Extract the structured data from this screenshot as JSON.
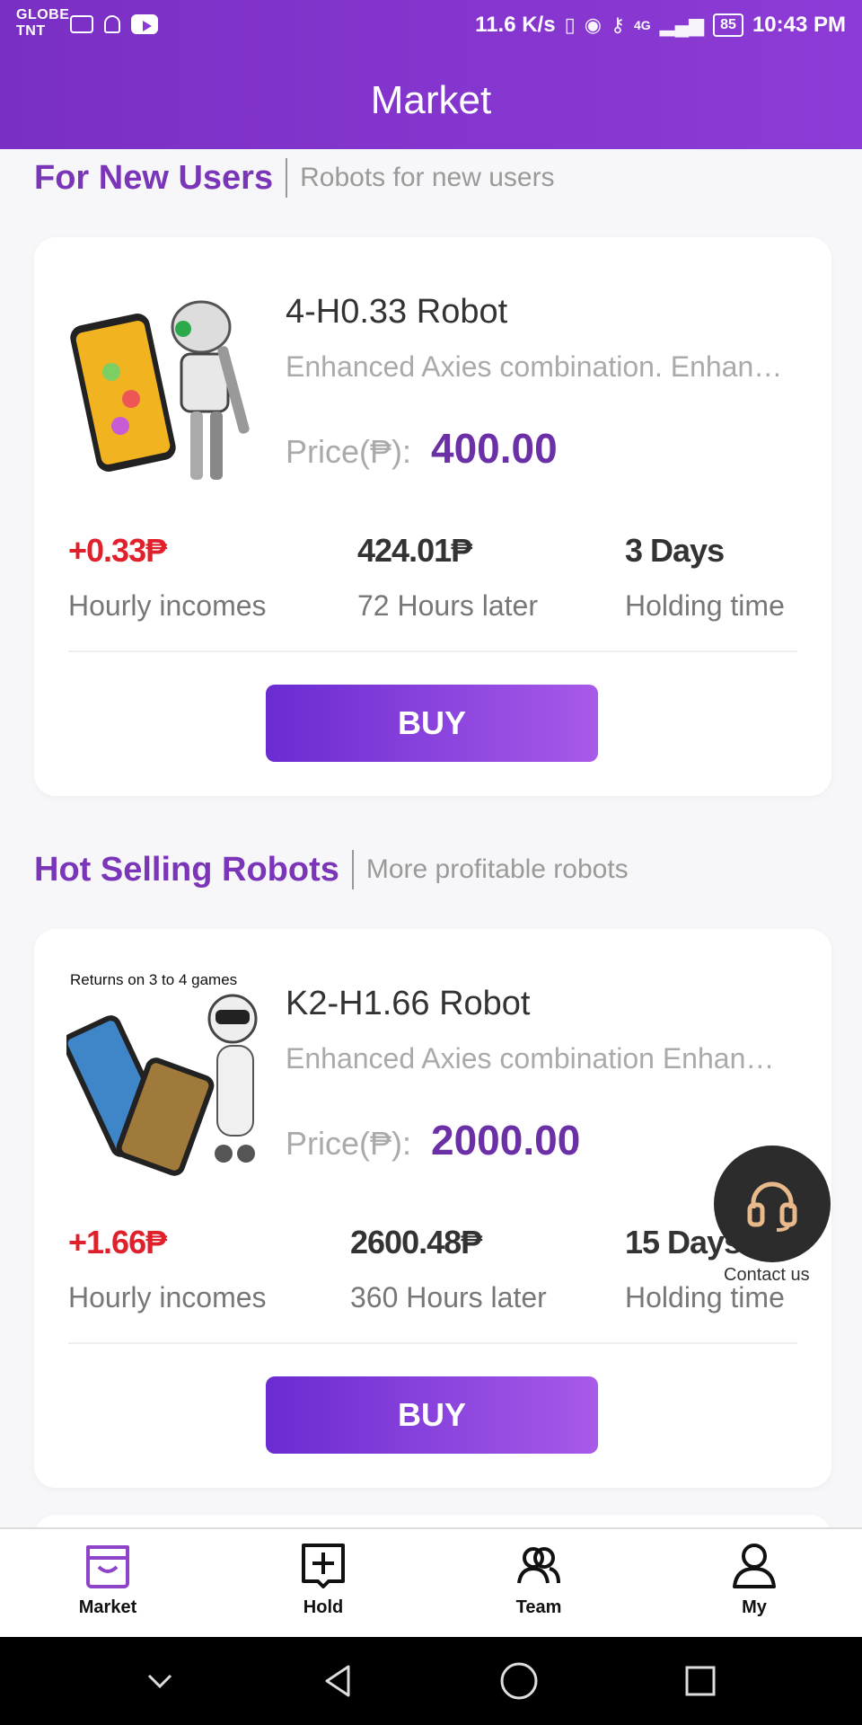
{
  "status_bar": {
    "carrier_line1": "GLOBE",
    "carrier_line2": "TNT",
    "net_speed": "11.6 K/s",
    "signal_4g": "4G",
    "battery": "85",
    "time": "10:43 PM"
  },
  "header": {
    "title": "Market"
  },
  "sections": [
    {
      "title": "For New Users",
      "subtitle": "Robots for new users",
      "card": {
        "name": "4-H0.33 Robot",
        "description": "Enhanced Axies combination. Enhan…",
        "price_label": "Price(₱):",
        "price": "400.00",
        "stats": [
          {
            "value": "+0.33₱",
            "label": "Hourly incomes"
          },
          {
            "value": "424.01₱",
            "label": "72 Hours later"
          },
          {
            "value": "3 Days",
            "label": "Holding time"
          }
        ],
        "buy_label": "BUY"
      }
    },
    {
      "title": "Hot Selling Robots",
      "subtitle": "More profitable robots",
      "card": {
        "image_caption": "Returns on 3 to 4 games",
        "name": "K2-H1.66 Robot",
        "description": "Enhanced Axies combination Enhan…",
        "price_label": "Price(₱):",
        "price": "2000.00",
        "stats": [
          {
            "value": "+1.66₱",
            "label": "Hourly incomes"
          },
          {
            "value": "2600.48₱",
            "label": "360 Hours later"
          },
          {
            "value": "15 Days",
            "label": "Holding time"
          }
        ],
        "buy_label": "BUY"
      }
    }
  ],
  "contact": {
    "label": "Contact us",
    "icon": "headset-icon"
  },
  "tabs": [
    {
      "label": "Market",
      "icon": "store-icon",
      "active": true,
      "color": "#8e44c8"
    },
    {
      "label": "Hold",
      "icon": "plus-square-icon",
      "active": false
    },
    {
      "label": "Team",
      "icon": "team-icon",
      "active": false
    },
    {
      "label": "My",
      "icon": "user-icon",
      "active": false
    }
  ],
  "colors": {
    "brand": "#8d3bd6",
    "price": "#6b2fa6",
    "income": "#e0202b"
  }
}
